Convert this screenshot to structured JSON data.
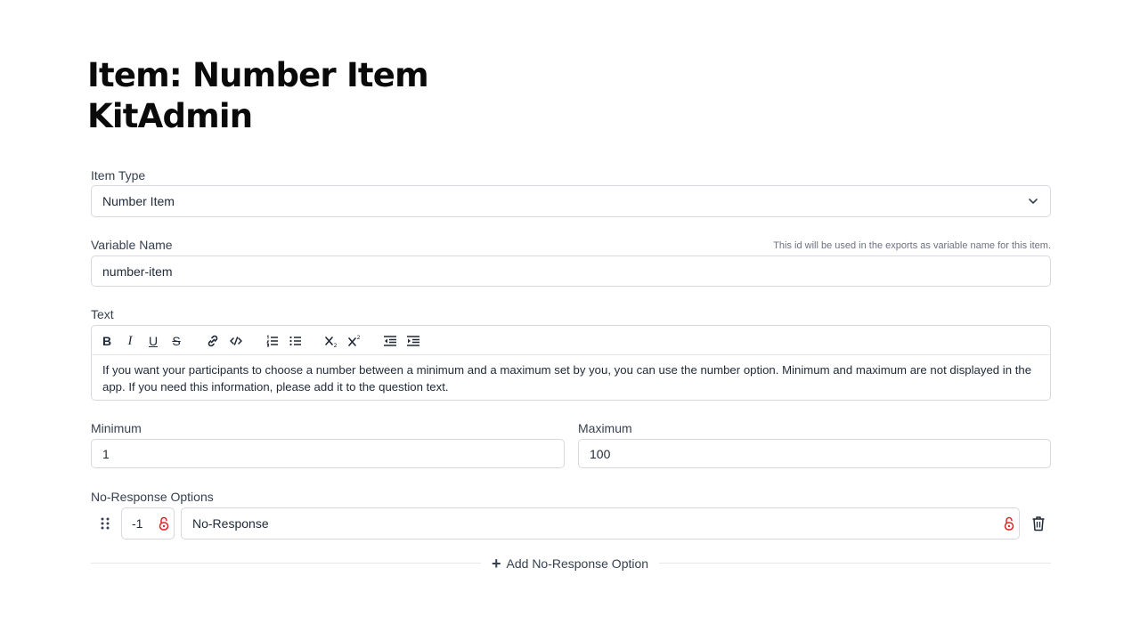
{
  "page": {
    "title_line1": "Item: Number Item",
    "title_line2": "KitAdmin"
  },
  "item_type": {
    "label": "Item Type",
    "value": "Number Item"
  },
  "variable_name": {
    "label": "Variable Name",
    "hint": "This id will be used in the exports as variable name for this item.",
    "value": "number-item"
  },
  "text": {
    "label": "Text",
    "toolbar": {
      "bold": "B",
      "italic": "I",
      "underline": "U",
      "strike": "S"
    },
    "content": "If you want your participants to choose a number between a minimum and a maximum set by you, you can use the number option. Minimum and maximum are not displayed in the app. If you need this information, please add it to the question text."
  },
  "minimum": {
    "label": "Minimum",
    "value": "1"
  },
  "maximum": {
    "label": "Maximum",
    "value": "100"
  },
  "no_response": {
    "label": "No-Response Options",
    "options": [
      {
        "code": "-1",
        "label": "No-Response"
      }
    ],
    "add_label": "Add No-Response Option"
  },
  "colors": {
    "lock_red": "#dc2626",
    "border": "#d6d9de"
  }
}
